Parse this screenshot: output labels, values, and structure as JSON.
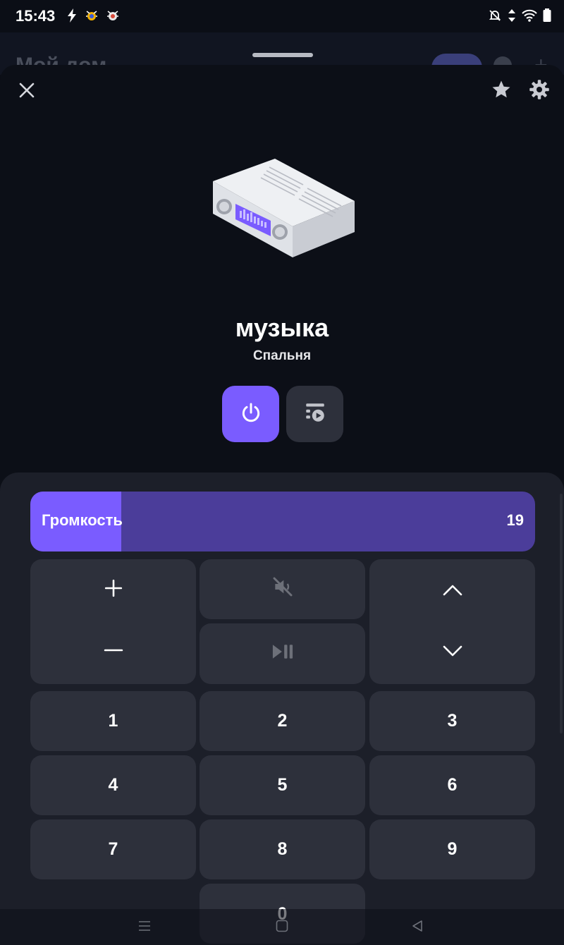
{
  "status_bar": {
    "time": "15:43",
    "left_icons": [
      "flash-icon",
      "bug-icon",
      "bug-alt-icon"
    ],
    "right_icons": [
      "mute-bell-icon",
      "data-arrows-icon",
      "wifi-icon",
      "battery-icon"
    ]
  },
  "background_app": {
    "title": "Мой дом"
  },
  "header": {
    "close_icon": "close-icon",
    "favorite_icon": "star-icon",
    "settings_icon": "gear-icon"
  },
  "device": {
    "name": "музыка",
    "room": "Спальня",
    "image": "radio-receiver-illustration"
  },
  "actions": {
    "power_icon": "power-icon",
    "sources_icon": "playlist-play-icon",
    "accent_color": "#7a5cff"
  },
  "volume": {
    "label": "Громкость",
    "value": "19",
    "level": 0.18
  },
  "remote": {
    "volume_up_icon": "plus-icon",
    "volume_down_icon": "minus-icon",
    "mute_icon": "mute-speaker-icon",
    "play_pause_icon": "play-pause-icon",
    "channel_up_icon": "chevron-up-icon",
    "channel_down_icon": "chevron-down-icon",
    "digits": [
      "1",
      "2",
      "3",
      "4",
      "5",
      "6",
      "7",
      "8",
      "9",
      "0"
    ]
  },
  "nav_bar": {
    "icons": [
      "menu-icon",
      "home-square-icon",
      "back-triangle-icon"
    ]
  }
}
